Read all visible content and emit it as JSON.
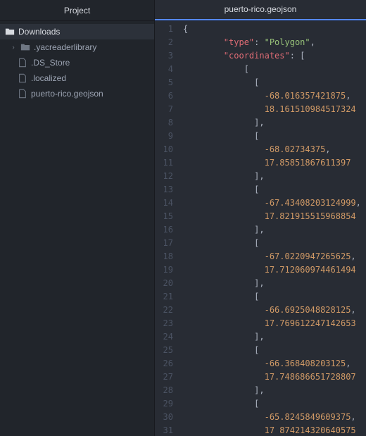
{
  "sidebar": {
    "header": "Project",
    "root": {
      "label": "Downloads"
    },
    "items": [
      {
        "label": ".yacreaderlibrary",
        "kind": "folder"
      },
      {
        "label": ".DS_Store",
        "kind": "file"
      },
      {
        "label": ".localized",
        "kind": "file"
      },
      {
        "label": "puerto-rico.geojson",
        "kind": "file"
      }
    ]
  },
  "editor": {
    "tab_title": "puerto-rico.geojson"
  },
  "code_lines": [
    {
      "n": 1,
      "kind": "brace",
      "indent": 0,
      "text": "{"
    },
    {
      "n": 2,
      "kind": "kv_str",
      "indent": 8,
      "key": "\"type\"",
      "sep": ": ",
      "val": "\"Polygon\"",
      "tail": ","
    },
    {
      "n": 3,
      "kind": "kv_arr",
      "indent": 8,
      "key": "\"coordinates\"",
      "sep": ": ",
      "open": "["
    },
    {
      "n": 4,
      "kind": "arr",
      "indent": 12,
      "text": "["
    },
    {
      "n": 5,
      "kind": "arr",
      "indent": 14,
      "text": "["
    },
    {
      "n": 6,
      "kind": "num",
      "indent": 16,
      "text": "-68.016357421875",
      "tail": ","
    },
    {
      "n": 7,
      "kind": "num",
      "indent": 16,
      "text": "18.161510984517324"
    },
    {
      "n": 8,
      "kind": "arr",
      "indent": 14,
      "text": "]",
      "tail": ","
    },
    {
      "n": 9,
      "kind": "arr",
      "indent": 14,
      "text": "["
    },
    {
      "n": 10,
      "kind": "num",
      "indent": 16,
      "text": "-68.02734375",
      "tail": ","
    },
    {
      "n": 11,
      "kind": "num",
      "indent": 16,
      "text": "17.85851867611397"
    },
    {
      "n": 12,
      "kind": "arr",
      "indent": 14,
      "text": "]",
      "tail": ","
    },
    {
      "n": 13,
      "kind": "arr",
      "indent": 14,
      "text": "["
    },
    {
      "n": 14,
      "kind": "num",
      "indent": 16,
      "text": "-67.43408203124999",
      "tail": ","
    },
    {
      "n": 15,
      "kind": "num",
      "indent": 16,
      "text": "17.821915515968854"
    },
    {
      "n": 16,
      "kind": "arr",
      "indent": 14,
      "text": "]",
      "tail": ","
    },
    {
      "n": 17,
      "kind": "arr",
      "indent": 14,
      "text": "["
    },
    {
      "n": 18,
      "kind": "num",
      "indent": 16,
      "text": "-67.0220947265625",
      "tail": ","
    },
    {
      "n": 19,
      "kind": "num",
      "indent": 16,
      "text": "17.712060974461494"
    },
    {
      "n": 20,
      "kind": "arr",
      "indent": 14,
      "text": "]",
      "tail": ","
    },
    {
      "n": 21,
      "kind": "arr",
      "indent": 14,
      "text": "["
    },
    {
      "n": 22,
      "kind": "num",
      "indent": 16,
      "text": "-66.6925048828125",
      "tail": ","
    },
    {
      "n": 23,
      "kind": "num",
      "indent": 16,
      "text": "17.769612247142653"
    },
    {
      "n": 24,
      "kind": "arr",
      "indent": 14,
      "text": "]",
      "tail": ","
    },
    {
      "n": 25,
      "kind": "arr",
      "indent": 14,
      "text": "["
    },
    {
      "n": 26,
      "kind": "num",
      "indent": 16,
      "text": "-66.368408203125",
      "tail": ","
    },
    {
      "n": 27,
      "kind": "num",
      "indent": 16,
      "text": "17.748686651728807"
    },
    {
      "n": 28,
      "kind": "arr",
      "indent": 14,
      "text": "]",
      "tail": ","
    },
    {
      "n": 29,
      "kind": "arr",
      "indent": 14,
      "text": "["
    },
    {
      "n": 30,
      "kind": "num",
      "indent": 16,
      "text": "-65.8245849609375",
      "tail": ","
    },
    {
      "n": 31,
      "kind": "numcut",
      "indent": 16,
      "text": "17 874214320640575"
    }
  ]
}
